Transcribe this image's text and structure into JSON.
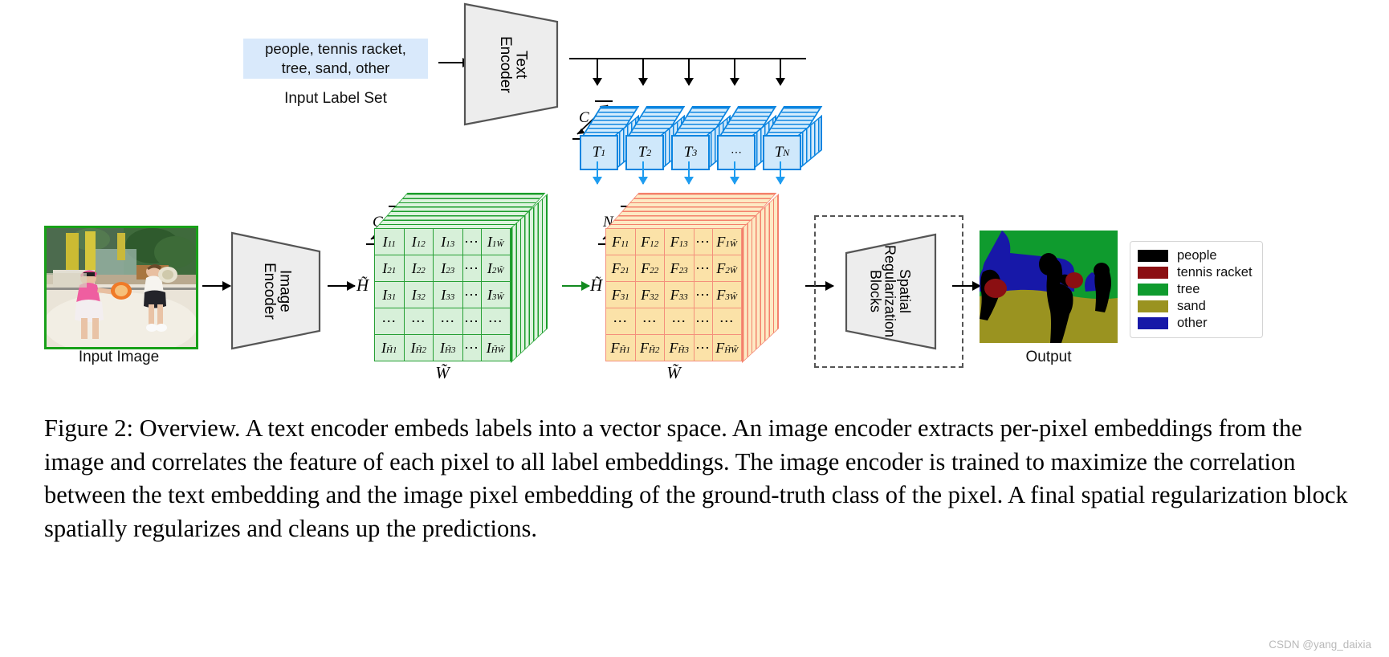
{
  "figure": {
    "number": "Figure 2",
    "title": "Overview.",
    "caption": "Figure 2: Overview. A text encoder embeds labels into a vector space. An image encoder extracts per-pixel embeddings from the image and correlates the feature of each pixel to all label embeddings. The image encoder is trained to maximize the correlation between the text embedding and the image pixel embedding of the ground-truth class of the pixel. A final spatial regularization block spatially regularizes and cleans up the predictions."
  },
  "watermark": "CSDN @yang_daixia",
  "text_branch": {
    "label_set_text": "people, tennis racket,\ntree, sand, other",
    "label_set_caption": "Input Label Set",
    "encoder_label": "Text\nEncoder",
    "channel_dim": "C",
    "tokens": [
      {
        "base": "T",
        "sub": "1"
      },
      {
        "base": "T",
        "sub": "2"
      },
      {
        "base": "T",
        "sub": "3"
      },
      {
        "base": "⋯",
        "sub": ""
      },
      {
        "base": "T",
        "sub": "N"
      }
    ]
  },
  "image_branch": {
    "input_caption": "Input Image",
    "encoder_label": "Image\nEncoder",
    "height_dim": "H̃",
    "width_dim": "W̃",
    "channel_dim": "C",
    "matrix_symbol": "I",
    "rows": [
      [
        "I|11",
        "I|12",
        "I|13",
        "⋯",
        "I|1W̃"
      ],
      [
        "I|21",
        "I|22",
        "I|23",
        "⋯",
        "I|2W̃"
      ],
      [
        "I|31",
        "I|32",
        "I|33",
        "⋯",
        "I|3W̃"
      ],
      [
        "⋯",
        "⋯",
        "⋯",
        "⋯",
        "⋯"
      ],
      [
        "I|H̃1",
        "I|H̃2",
        "I|H̃3",
        "⋯",
        "I|H̃W̃"
      ]
    ]
  },
  "fusion": {
    "height_dim": "H̃",
    "width_dim": "W̃",
    "class_dim": "N",
    "matrix_symbol": "F",
    "rows": [
      [
        "F|11",
        "F|12",
        "F|13",
        "⋯",
        "F|1W̃"
      ],
      [
        "F|21",
        "F|22",
        "F|23",
        "⋯",
        "F|2W̃"
      ],
      [
        "F|31",
        "F|32",
        "F|33",
        "⋯",
        "F|3W̃"
      ],
      [
        "⋯",
        "⋯",
        "⋯",
        "⋯",
        "⋯"
      ],
      [
        "F|H̃1",
        "F|H̃2",
        "F|H̃3",
        "⋯",
        "F|H̃W̃"
      ]
    ]
  },
  "regularization": {
    "block_label": "Spatial\nRegularization\nBlocks"
  },
  "output": {
    "caption": "Output",
    "legend": [
      {
        "label": "people",
        "color": "#000000"
      },
      {
        "label": "tennis racket",
        "color": "#8b0f12"
      },
      {
        "label": "tree",
        "color": "#0f9b2e"
      },
      {
        "label": "sand",
        "color": "#9a9320"
      },
      {
        "label": "other",
        "color": "#1718a8"
      }
    ]
  },
  "colors": {
    "text_token_fill": "#cfe8fb",
    "text_token_stroke": "#0a84e0",
    "image_feature_fill": "#d7f0d9",
    "image_feature_stroke": "#27a035",
    "fused_feature_fill": "#fbe2a8",
    "fused_feature_stroke": "#f4907c",
    "encoder_fill": "#ededed",
    "label_box_fill": "#d9e9fb",
    "photo_border": "#18a018"
  }
}
